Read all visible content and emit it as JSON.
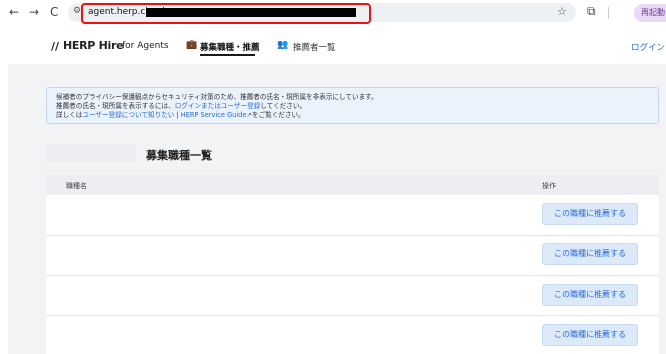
{
  "browser": {
    "back_icon": "←",
    "forward_icon": "→",
    "reload_icon": "C",
    "url": "agent.herp.cloud",
    "restart_label": "再起動"
  },
  "header": {
    "logo_mark": "//",
    "logo_text": "HERP Hire",
    "logo_sub": "for Agents",
    "nav": [
      {
        "label": "募集職種・推薦"
      },
      {
        "label": "推薦者一覧"
      }
    ],
    "login_label": "ログイン"
  },
  "notice": {
    "line1": "候補者のプライバシー保護観点からセキュリティ対策のため、推薦者の氏名・現所属を非表示にしています。",
    "line2_pre": "推薦者の氏名・現所属を表示するには、",
    "line2_link": "ログインまたはユーザー登録",
    "line2_post": "してください。",
    "line3_pre": "詳しくは",
    "line3_link1": "ユーザー登録について知りたい",
    "line3_sep": " | ",
    "line3_link2": "HERP Service Guide",
    "line3_post": "をご覧ください。"
  },
  "main": {
    "page_title": "募集職種一覧",
    "columns": [
      "職種名",
      "操作"
    ],
    "rows": [
      {
        "name": "",
        "action": "この職種に推薦する"
      },
      {
        "name": "",
        "action": "この職種に推薦する"
      },
      {
        "name": "",
        "action": "この職種に推薦する"
      },
      {
        "name": "",
        "action": "この職種に推薦する"
      }
    ]
  }
}
